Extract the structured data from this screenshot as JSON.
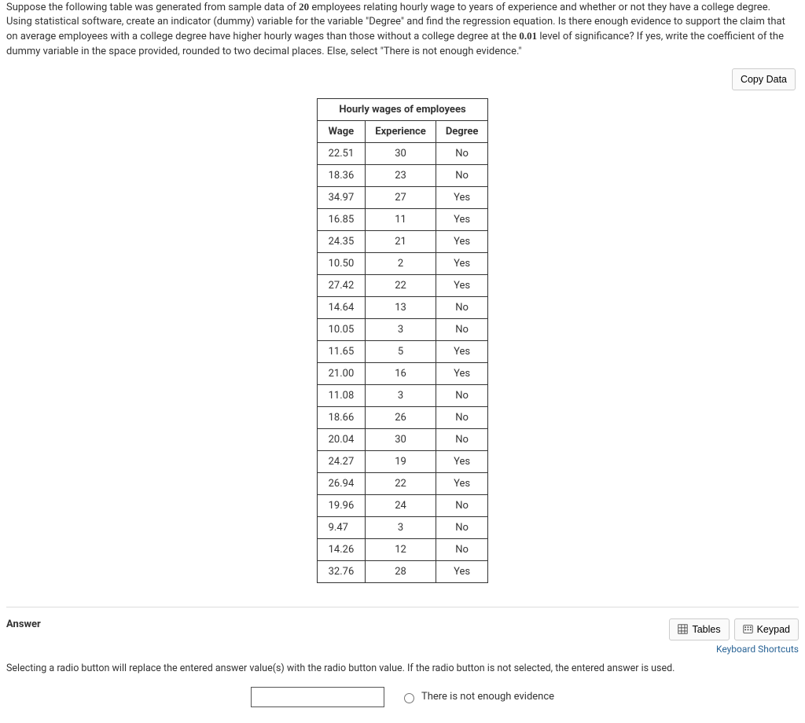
{
  "question": {
    "pre1": "Suppose the following table was generated from sample data of ",
    "n": "20",
    "post1": " employees relating hourly wage to years of experience and whether or not they have a college degree. Using statistical software, create an indicator (dummy) variable for the variable \"Degree\" and find the regression equation. Is there enough evidence to support the claim that on average employees with a college degree have higher hourly wages than those without a college degree at the ",
    "alpha": "0.01",
    "post2": " level of significance? If yes, write the coefficient of the dummy variable in the space provided, rounded to two decimal places. Else, select \"There is not enough evidence.\""
  },
  "copy_btn": "Copy Data",
  "table": {
    "caption": "Hourly wages of employees",
    "headers": [
      "Wage",
      "Experience",
      "Degree"
    ],
    "rows": [
      [
        "22.51",
        "30",
        "No"
      ],
      [
        "18.36",
        "23",
        "No"
      ],
      [
        "34.97",
        "27",
        "Yes"
      ],
      [
        "16.85",
        "11",
        "Yes"
      ],
      [
        "24.35",
        "21",
        "Yes"
      ],
      [
        "10.50",
        "2",
        "Yes"
      ],
      [
        "27.42",
        "22",
        "Yes"
      ],
      [
        "14.64",
        "13",
        "No"
      ],
      [
        "10.05",
        "3",
        "No"
      ],
      [
        "11.65",
        "5",
        "Yes"
      ],
      [
        "21.00",
        "16",
        "Yes"
      ],
      [
        "11.08",
        "3",
        "No"
      ],
      [
        "18.66",
        "26",
        "No"
      ],
      [
        "20.04",
        "30",
        "No"
      ],
      [
        "24.27",
        "19",
        "Yes"
      ],
      [
        "26.94",
        "22",
        "Yes"
      ],
      [
        "19.96",
        "24",
        "No"
      ],
      [
        "9.47",
        "3",
        "No"
      ],
      [
        "14.26",
        "12",
        "No"
      ],
      [
        "32.76",
        "28",
        "Yes"
      ]
    ]
  },
  "answer": {
    "title": "Answer",
    "tables_btn": "Tables",
    "keypad_btn": "Keypad",
    "kb_shortcuts": "Keyboard Shortcuts",
    "hint": "Selecting a radio button will replace the entered answer value(s) with the radio button value. If the radio button is not selected, the entered answer is used.",
    "radio_label": "There is not enough evidence"
  }
}
